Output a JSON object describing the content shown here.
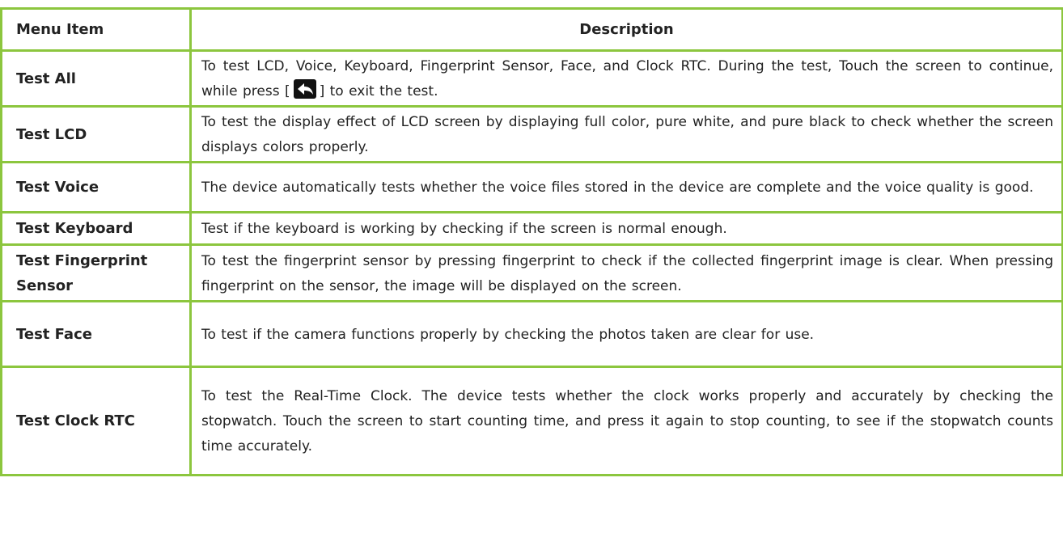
{
  "table": {
    "headers": {
      "item": "Menu Item",
      "description": "Description"
    },
    "rows": [
      {
        "item": "Test All",
        "desc_before_icon": "To test LCD, Voice, Keyboard, Fingerprint Sensor, Face, and Clock RTC. During the test, Touch the screen to continue, while press [",
        "icon": "back-arrow-icon",
        "desc_after_icon": "] to exit the test."
      },
      {
        "item": "Test LCD",
        "desc": "To test the display effect of LCD screen by displaying full color, pure white, and pure black to check whether the screen displays colors properly."
      },
      {
        "item": "Test Voice",
        "desc": "The device automatically tests whether the voice files stored in the device are complete and the voice quality is good."
      },
      {
        "item": "Test Keyboard",
        "desc": "Test if the keyboard is working by checking if the screen is normal enough."
      },
      {
        "item": "Test Fingerprint Sensor",
        "desc": "To test the fingerprint sensor by pressing fingerprint to check if the collected fingerprint image is clear. When pressing fingerprint on the sensor, the image will be displayed on the screen."
      },
      {
        "item": "Test Face",
        "desc": "To test if the camera functions properly by checking the photos taken are clear for use."
      },
      {
        "item": "Test Clock RTC",
        "desc": "To test the Real-Time Clock. The device tests whether the clock works properly and accurately by checking the stopwatch. Touch the screen to start counting time, and press it again to stop counting, to see if the stopwatch counts time accurately."
      }
    ]
  },
  "colors": {
    "border": "#8cc63e",
    "text": "#222222",
    "icon_background": "#111111",
    "icon_arrow": "#ffffff"
  }
}
